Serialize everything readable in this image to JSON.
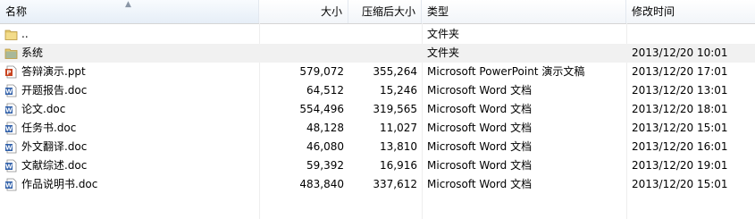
{
  "columns": {
    "name": "名称",
    "size": "大小",
    "compressed": "压缩后大小",
    "type": "类型",
    "modified": "修改时间"
  },
  "rows": [
    {
      "icon": "folder-up-icon",
      "name": "..",
      "size": "",
      "compressed": "",
      "type": "文件夹",
      "modified": ""
    },
    {
      "icon": "folder-icon",
      "name": "系统",
      "size": "",
      "compressed": "",
      "type": "文件夹",
      "modified": "2013/12/20 10:01"
    },
    {
      "icon": "ppt-file-icon",
      "name": "答辩演示.ppt",
      "size": "579,072",
      "compressed": "355,264",
      "type": "Microsoft PowerPoint 演示文稿",
      "modified": "2013/12/20 17:01"
    },
    {
      "icon": "word-file-icon",
      "name": "开题报告.doc",
      "size": "64,512",
      "compressed": "15,246",
      "type": "Microsoft Word 文档",
      "modified": "2013/12/20 13:01"
    },
    {
      "icon": "word-file-icon",
      "name": "论文.doc",
      "size": "554,496",
      "compressed": "319,565",
      "type": "Microsoft Word 文档",
      "modified": "2013/12/20 18:01"
    },
    {
      "icon": "word-file-icon",
      "name": "任务书.doc",
      "size": "48,128",
      "compressed": "11,027",
      "type": "Microsoft Word 文档",
      "modified": "2013/12/20 15:01"
    },
    {
      "icon": "word-file-icon",
      "name": "外文翻译.doc",
      "size": "46,080",
      "compressed": "13,810",
      "type": "Microsoft Word 文档",
      "modified": "2013/12/20 16:01"
    },
    {
      "icon": "word-file-icon",
      "name": "文献综述.doc",
      "size": "59,392",
      "compressed": "16,916",
      "type": "Microsoft Word 文档",
      "modified": "2013/12/20 19:01"
    },
    {
      "icon": "word-file-icon",
      "name": "作品说明书.doc",
      "size": "483,840",
      "compressed": "337,612",
      "type": "Microsoft Word 文档",
      "modified": "2013/12/20 15:01"
    }
  ],
  "selected_row": 1,
  "colors": {
    "folder": "#e2c66b",
    "folder_dark": "#b8953a",
    "ppt": "#c8431f",
    "word": "#2e5ea8",
    "row_highlight": "#f1f1f1"
  }
}
